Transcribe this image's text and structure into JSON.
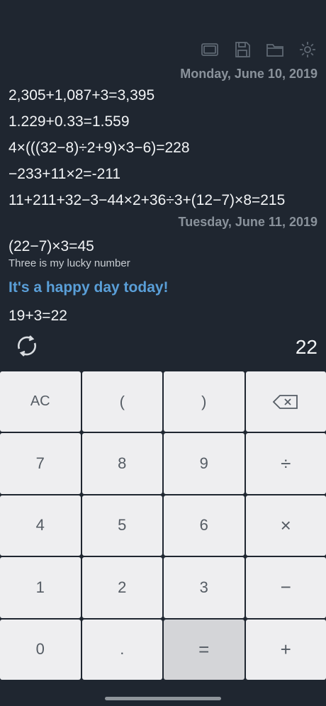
{
  "toolbar": {
    "icons": [
      "screen-icon",
      "save-icon",
      "folder-icon",
      "gear-icon"
    ]
  },
  "history": {
    "date1": "Monday, June 10, 2019",
    "lines1": [
      "2,305+1,087+3=3,395",
      "1.229+0.33=1.559",
      "4×(((32−8)÷2+9)×3−6)=228",
      "−233+11×2=-211",
      "11+211+32−3−44×2+36÷3+(12−7)×8=215"
    ],
    "date2": "Tuesday, June 11, 2019",
    "line2": "(22−7)×3=45",
    "note": "Three is my lucky number",
    "highlight": "It's a happy day today!",
    "line3": "19+3=22"
  },
  "display": {
    "result": "22"
  },
  "keys": {
    "ac": "AC",
    "lparen": "(",
    "rparen": ")",
    "k7": "7",
    "k8": "8",
    "k9": "9",
    "div": "÷",
    "k4": "4",
    "k5": "5",
    "k6": "6",
    "mul": "×",
    "k1": "1",
    "k2": "2",
    "k3": "3",
    "sub": "−",
    "k0": "0",
    "dot": ".",
    "eq": "=",
    "add": "+"
  },
  "colors": {
    "background": "#1f2630",
    "highlight": "#5a9fd8",
    "key": "#eeeef0",
    "key_equals": "#d4d5d8"
  }
}
